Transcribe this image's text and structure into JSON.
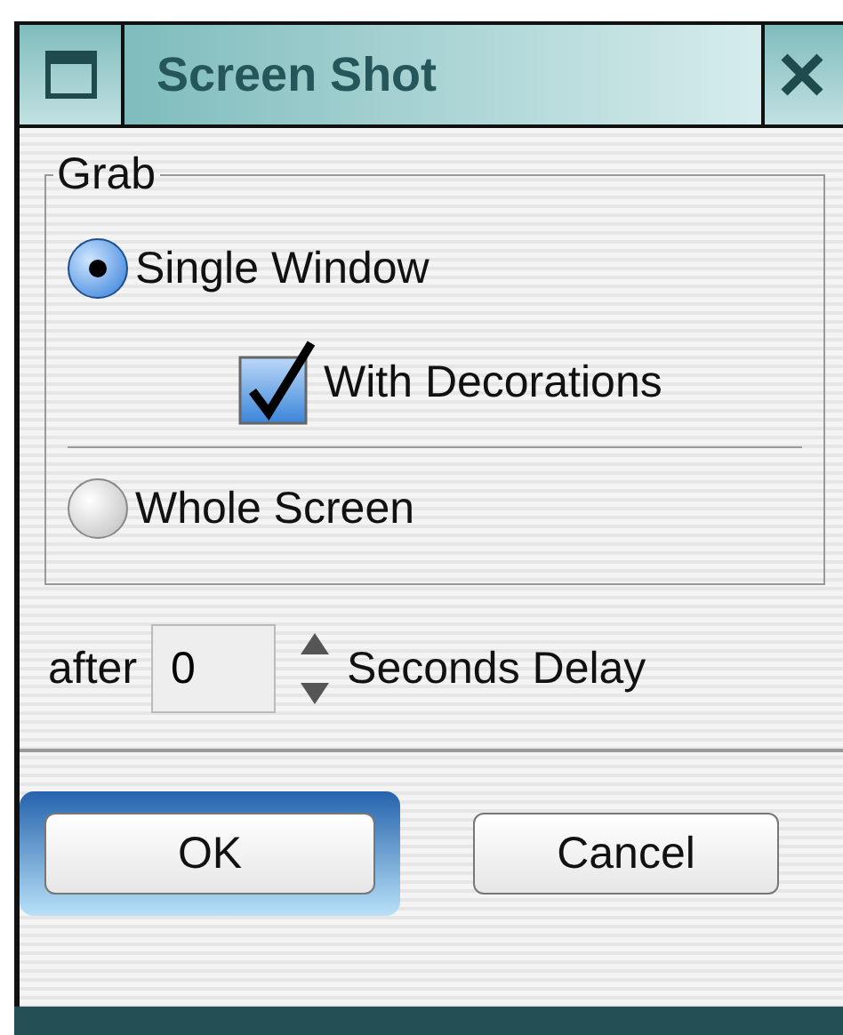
{
  "window": {
    "title": "Screen Shot"
  },
  "grab": {
    "title": "Grab",
    "options": [
      {
        "kind": "radio",
        "label": "Single Window",
        "selected": true
      },
      {
        "kind": "checkbox",
        "label": "With Decorations",
        "checked": true
      },
      {
        "kind": "separator"
      },
      {
        "kind": "radio",
        "label": "Whole Screen",
        "selected": false
      }
    ]
  },
  "delay": {
    "prefix": "after",
    "value": "0",
    "suffix": "Seconds Delay"
  },
  "buttons": [
    {
      "label": "OK",
      "default": true
    },
    {
      "label": "Cancel",
      "default": false
    }
  ]
}
